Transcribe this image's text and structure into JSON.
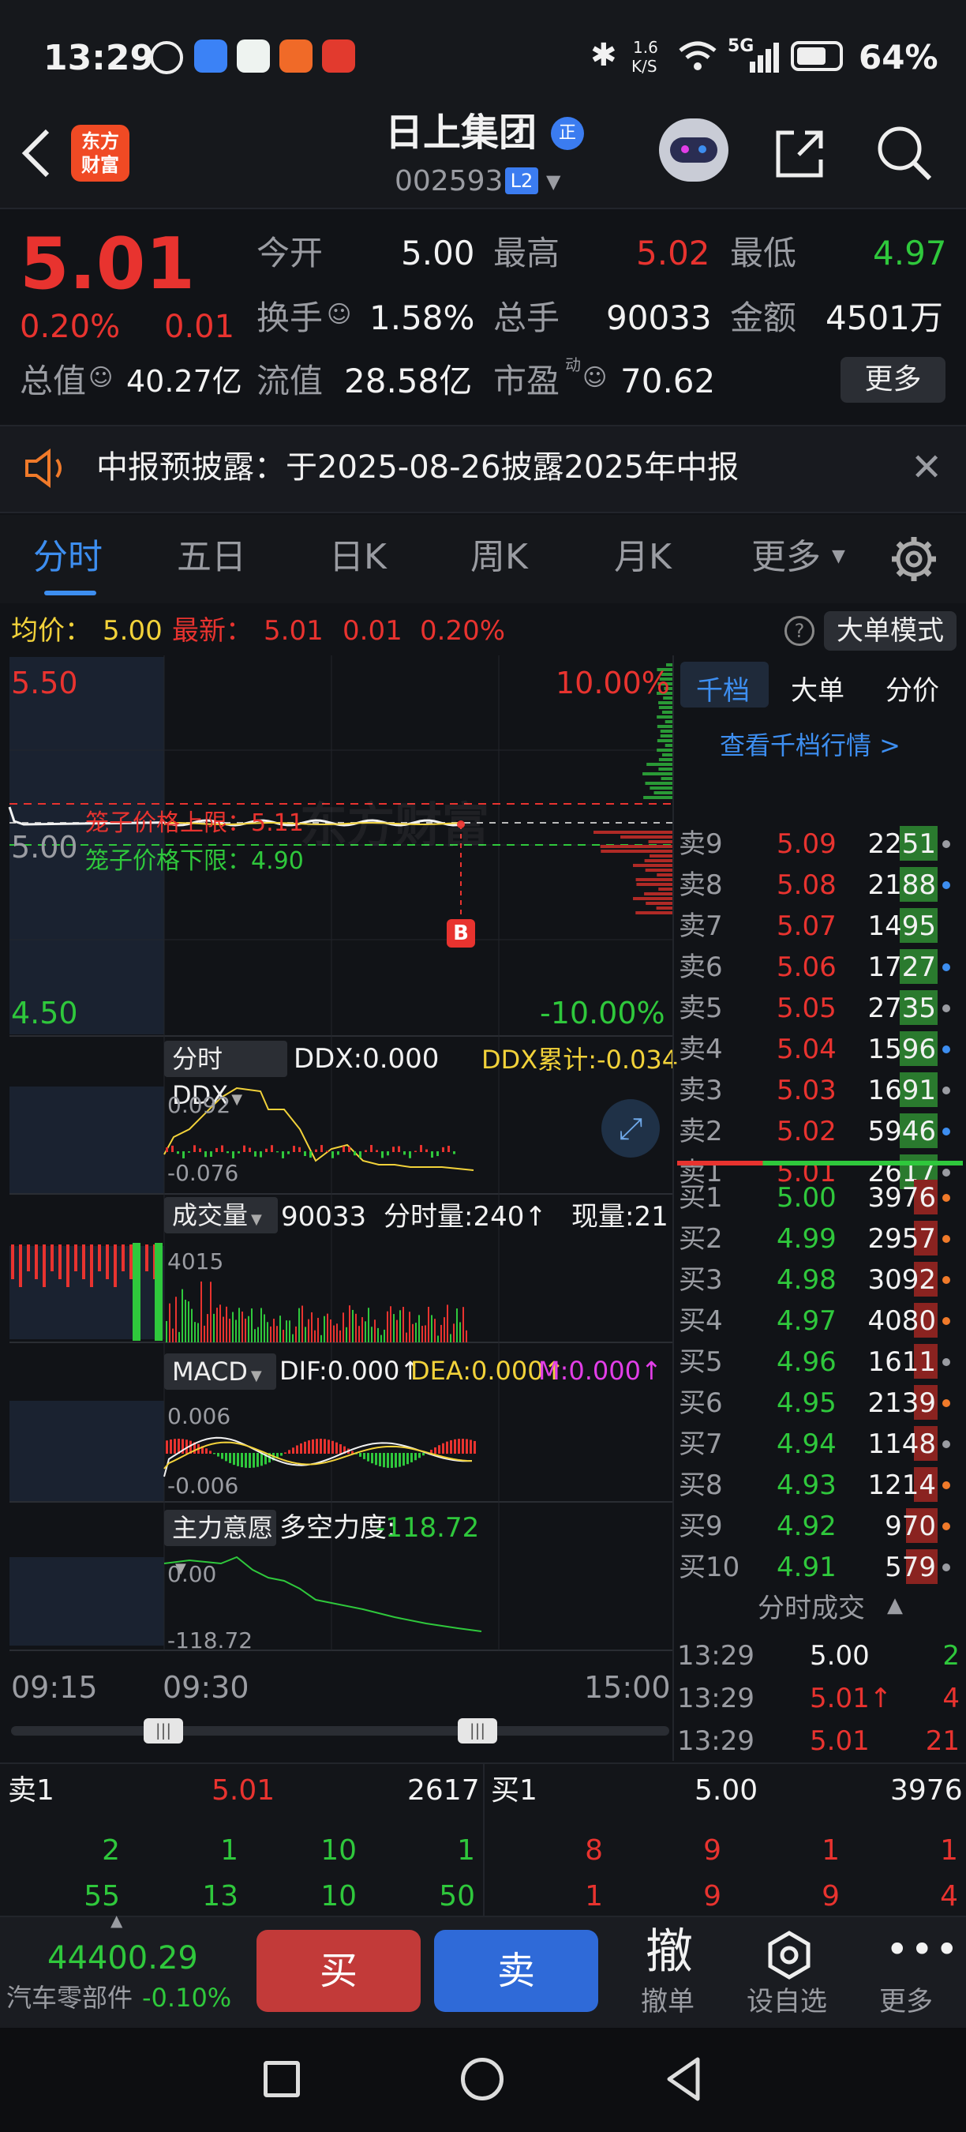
{
  "status_bar": {
    "time": "13:29",
    "net_speed_top": "1.6",
    "net_speed_bottom": "K/S",
    "network": "5G",
    "battery": "64%"
  },
  "header": {
    "logo_top": "东方",
    "logo_bottom": "财富",
    "stock_name": "日上集团",
    "badge": "正",
    "code": "002593",
    "level": "L2"
  },
  "quote": {
    "price": "5.01",
    "change_pct": "0.20%",
    "change": "0.01",
    "open_label": "今开",
    "open": "5.00",
    "high_label": "最高",
    "high": "5.02",
    "low_label": "最低",
    "low": "4.97",
    "turnover_label": "换手",
    "turnover": "1.58%",
    "volume_label": "总手",
    "volume": "90033",
    "amount_label": "金额",
    "amount": "4501万",
    "mktcap_label": "总值",
    "mktcap": "40.27亿",
    "float_label": "流值",
    "float": "28.58亿",
    "pe_label": "市盈",
    "pe_sup": "动",
    "pe": "70.62",
    "more": "更多"
  },
  "notice": {
    "text": "中报预披露：于2025-08-26披露2025年中报"
  },
  "tabs": [
    "分时",
    "五日",
    "日K",
    "周K",
    "月K",
    "更多"
  ],
  "info_bar": {
    "avg_label": "均价：",
    "avg": "5.00",
    "last_label": "最新：",
    "last": "5.01",
    "chg": "0.01",
    "pct": "0.20%",
    "mode": "大单模式"
  },
  "chart": {
    "y_high": "5.50",
    "y_mid": "5.00",
    "y_low": "4.50",
    "pct_high": "10.00%",
    "pct_low": "-10.00%",
    "upper_limit": "笼子价格上限：5.11",
    "lower_limit": "笼子价格下限：4.90",
    "marker": "B",
    "watermark": "东方财富",
    "ddx_title": "分时DDX",
    "ddx": "DDX:0.000",
    "ddx_cum": "DDX累计:-0.034",
    "ddx_top": "0.092",
    "ddx_bot": "-0.076",
    "vol_title": "成交量",
    "vol": "90033",
    "vol_min": "分时量:240↑",
    "vol_now": "现量:21",
    "vol_top": "4015",
    "macd_title": "MACD",
    "dif": "DIF:0.000↑",
    "dea": "DEA:0.000↑",
    "m": "M:0.000↑",
    "macd_top": "0.006",
    "macd_bot": "-0.006",
    "main_title": "主力意愿",
    "power": "多空力度:",
    "power_val": "-118.72",
    "main_top": "0.00",
    "main_bot": "-118.72",
    "t_start": "09:15",
    "t_open": "09:30",
    "t_end": "15:00"
  },
  "order_tabs": [
    "千档",
    "大单",
    "分价"
  ],
  "order_link": "查看千档行情 >",
  "asks": [
    {
      "label": "卖9",
      "price": "5.09",
      "vol": "2251",
      "dot": "#9a9ca2"
    },
    {
      "label": "卖8",
      "price": "5.08",
      "vol": "2188",
      "dot": "#3d8ef0"
    },
    {
      "label": "卖7",
      "price": "5.07",
      "vol": "1495",
      "dot": ""
    },
    {
      "label": "卖6",
      "price": "5.06",
      "vol": "1727",
      "dot": "#3d8ef0"
    },
    {
      "label": "卖5",
      "price": "5.05",
      "vol": "2735",
      "dot": "#9a9ca2"
    },
    {
      "label": "卖4",
      "price": "5.04",
      "vol": "1596",
      "dot": "#3d8ef0"
    },
    {
      "label": "卖3",
      "price": "5.03",
      "vol": "1691",
      "dot": "#9a9ca2"
    },
    {
      "label": "卖2",
      "price": "5.02",
      "vol": "5946",
      "dot": "#3d8ef0"
    },
    {
      "label": "卖1",
      "price": "5.01",
      "vol": "2617",
      "dot": "#9a9ca2"
    }
  ],
  "bids": [
    {
      "label": "买1",
      "price": "5.00",
      "vol": "3976",
      "dot": "#f07a2a"
    },
    {
      "label": "买2",
      "price": "4.99",
      "vol": "2957",
      "dot": "#f07a2a"
    },
    {
      "label": "买3",
      "price": "4.98",
      "vol": "3092",
      "dot": "#f07a2a"
    },
    {
      "label": "买4",
      "price": "4.97",
      "vol": "4080",
      "dot": "#f07a2a"
    },
    {
      "label": "买5",
      "price": "4.96",
      "vol": "1611",
      "dot": "#9a9ca2"
    },
    {
      "label": "买6",
      "price": "4.95",
      "vol": "2139",
      "dot": "#f07a2a"
    },
    {
      "label": "买7",
      "price": "4.94",
      "vol": "1148",
      "dot": "#9a9ca2"
    },
    {
      "label": "买8",
      "price": "4.93",
      "vol": "1214",
      "dot": "#f07a2a"
    },
    {
      "label": "买9",
      "price": "4.92",
      "vol": "970",
      "dot": "#f07a2a"
    },
    {
      "label": "买10",
      "price": "4.91",
      "vol": "579",
      "dot": "#9a9ca2"
    }
  ],
  "ticks_title": "分时成交",
  "ticks": [
    {
      "time": "13:29",
      "price": "5.00",
      "vol": "2",
      "color": "#f2f2f2",
      "vcolor": "#2fc83c"
    },
    {
      "time": "13:29",
      "price": "5.01↑",
      "vol": "4",
      "color": "#e8332f",
      "vcolor": "#e8332f"
    },
    {
      "time": "13:29",
      "price": "5.01",
      "vol": "21",
      "color": "#e8332f",
      "vcolor": "#e8332f"
    }
  ],
  "bottom_book": {
    "ask_label": "卖1",
    "ask_price": "5.01",
    "ask_vol": "2617",
    "bid_label": "买1",
    "bid_price": "5.00",
    "bid_vol": "3976",
    "ask_row1": [
      "2",
      "1",
      "10",
      "1"
    ],
    "ask_row2": [
      "55",
      "13",
      "10",
      "50"
    ],
    "bid_row1": [
      "8",
      "9",
      "1",
      "1"
    ],
    "bid_row2": [
      "1",
      "9",
      "9",
      "4"
    ]
  },
  "toolbar": {
    "index": "44400.29",
    "sector": "汽车零部件",
    "sector_chg": "-0.10%",
    "buy": "买",
    "sell": "卖",
    "cancel_icon": "撤",
    "cancel": "撤单",
    "watch": "设自选",
    "more": "更多"
  },
  "colors": {
    "up": "#e8332f",
    "down": "#2fc83c",
    "avg": "#f2d23a",
    "bg": "#111317"
  }
}
